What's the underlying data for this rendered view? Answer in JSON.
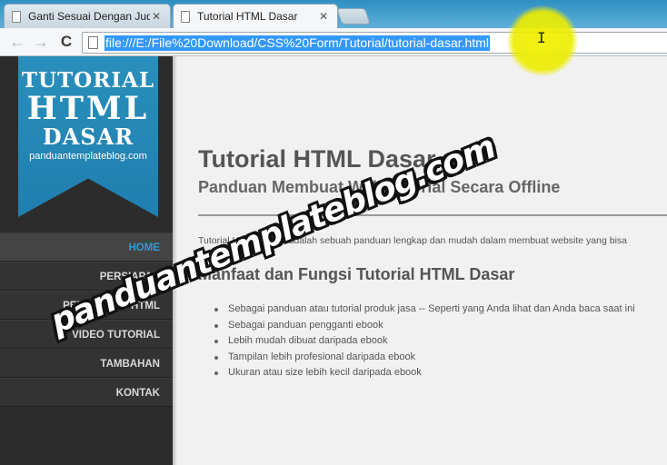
{
  "browser": {
    "tabs": [
      {
        "title": "Ganti Sesuai Dengan Judu",
        "close": "✕",
        "active": false
      },
      {
        "title": "Tutorial HTML Dasar",
        "close": "✕",
        "active": true
      }
    ],
    "nav": {
      "back": "←",
      "forward": "→",
      "reload": "C"
    },
    "url": "file:///E:/File%20Download/CSS%20Form/Tutorial/tutorial-dasar.html",
    "cursor": "I"
  },
  "sidebar": {
    "logo": {
      "line1": "TUTORIAL",
      "line2": "HTML",
      "line3": "DASAR",
      "site": "panduantemplateblog.com"
    },
    "menu": [
      {
        "label": "HOME"
      },
      {
        "label": "PERSIAPAN"
      },
      {
        "label": "PEMBUATAN HTML"
      },
      {
        "label": "VIDEO TUTORIAL"
      },
      {
        "label": "TAMBAHAN"
      },
      {
        "label": "KONTAK"
      }
    ],
    "active_item": "HOME",
    "accent_color": "#2d9cd6"
  },
  "main": {
    "title": "Tutorial HTML Dasar",
    "subtitle": "Panduan Membuat Web Tutorial Secara Offline",
    "intro": "Tutorial HTML Dasar adalah sebuah panduan lengkap dan mudah dalam membuat website yang bisa",
    "section_title": "Manfaat dan Fungsi Tutorial HTML Dasar",
    "list": [
      "Sebagai panduan atau tutorial produk jasa -- Seperti yang Anda lihat dan Anda baca saat ini",
      "Sebagai panduan pengganti ebook",
      "Lebih mudah dibuat daripada ebook",
      "Tampilan lebih profesional daripada ebook",
      "Ukuran atau size lebih kecil daripada ebook"
    ]
  },
  "watermark": "panduantemplateblog.com"
}
